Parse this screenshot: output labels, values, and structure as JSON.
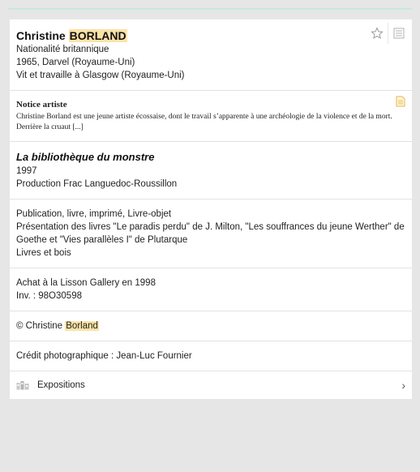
{
  "artist": {
    "first_name": "Christine",
    "last_name": "BORLAND",
    "nationality": "Nationalité britannique",
    "birth": "1965, Darvel (Royaume-Uni)",
    "lives": "Vit et travaille à Glasgow (Royaume-Uni)"
  },
  "icons": {
    "star": "star-icon",
    "list": "list-icon",
    "document": "document-icon",
    "exhibitions": "exhibitions-icon",
    "chevron": "chevron-right-icon"
  },
  "notice": {
    "title": "Notice artiste",
    "text": "Christine Borland est une jeune artiste écossaise, dont le travail s’apparente à une archéologie de la violence et de la mort. Derrière la cruaut [...]"
  },
  "work": {
    "title": "La bibliothèque du monstre",
    "year": "1997",
    "production": "Production Frac Languedoc-Roussillon"
  },
  "description": {
    "category": "Publication, livre, imprimé, Livre-objet",
    "presentation": "Présentation des livres \"Le paradis perdu\" de J. Milton, \"Les souffrances du jeune Werther\" de Goethe et \"Vies parallèles I\" de Plutarque",
    "materials": "Livres et bois"
  },
  "acquisition": {
    "text": "Achat à la Lisson Gallery en 1998",
    "inventory": "Inv. : 98O30598"
  },
  "copyright": {
    "prefix": "© Christine ",
    "name": "Borland"
  },
  "credit": "Crédit photographique : Jean-Luc Fournier",
  "exhibitions": {
    "label": "Expositions",
    "chevron": "›"
  },
  "colors": {
    "highlight": "#fbe3a8",
    "background": "#e6e6e6",
    "card": "#ffffff"
  }
}
